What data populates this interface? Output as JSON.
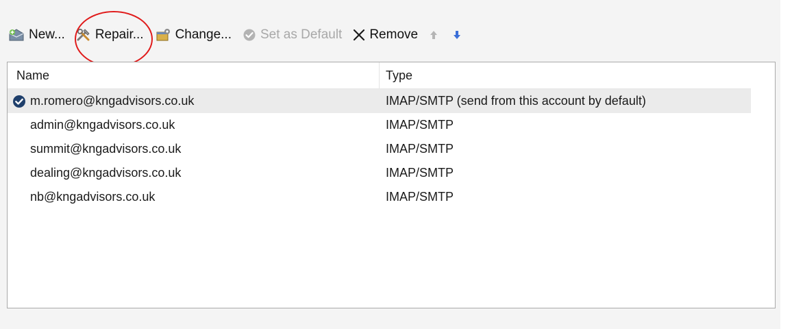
{
  "toolbar": {
    "new_label": "New...",
    "repair_label": "Repair...",
    "change_label": "Change...",
    "set_default_label": "Set as Default",
    "remove_label": "Remove",
    "new_icon": "new-account-icon",
    "repair_icon": "repair-tools-icon",
    "change_icon": "change-settings-icon",
    "set_default_icon": "check-circle-icon",
    "remove_icon": "x-icon",
    "up_icon": "arrow-up-icon",
    "down_icon": "arrow-down-icon"
  },
  "list": {
    "columns": [
      "Name",
      "Type"
    ],
    "rows": [
      {
        "name": "m.romero@kngadvisors.co.uk",
        "type": "IMAP/SMTP (send from this account by default)",
        "default": true
      },
      {
        "name": "admin@kngadvisors.co.uk",
        "type": "IMAP/SMTP",
        "default": false
      },
      {
        "name": "summit@kngadvisors.co.uk",
        "type": "IMAP/SMTP",
        "default": false
      },
      {
        "name": "dealing@kngadvisors.co.uk",
        "type": "IMAP/SMTP",
        "default": false
      },
      {
        "name": "nb@kngadvisors.co.uk",
        "type": "IMAP/SMTP",
        "default": false
      }
    ]
  },
  "colors": {
    "annotation": "#e01b1b",
    "default_check": "#1f3f6b",
    "down_arrow": "#3b6fd8",
    "disabled_text": "#a8a8a8"
  }
}
